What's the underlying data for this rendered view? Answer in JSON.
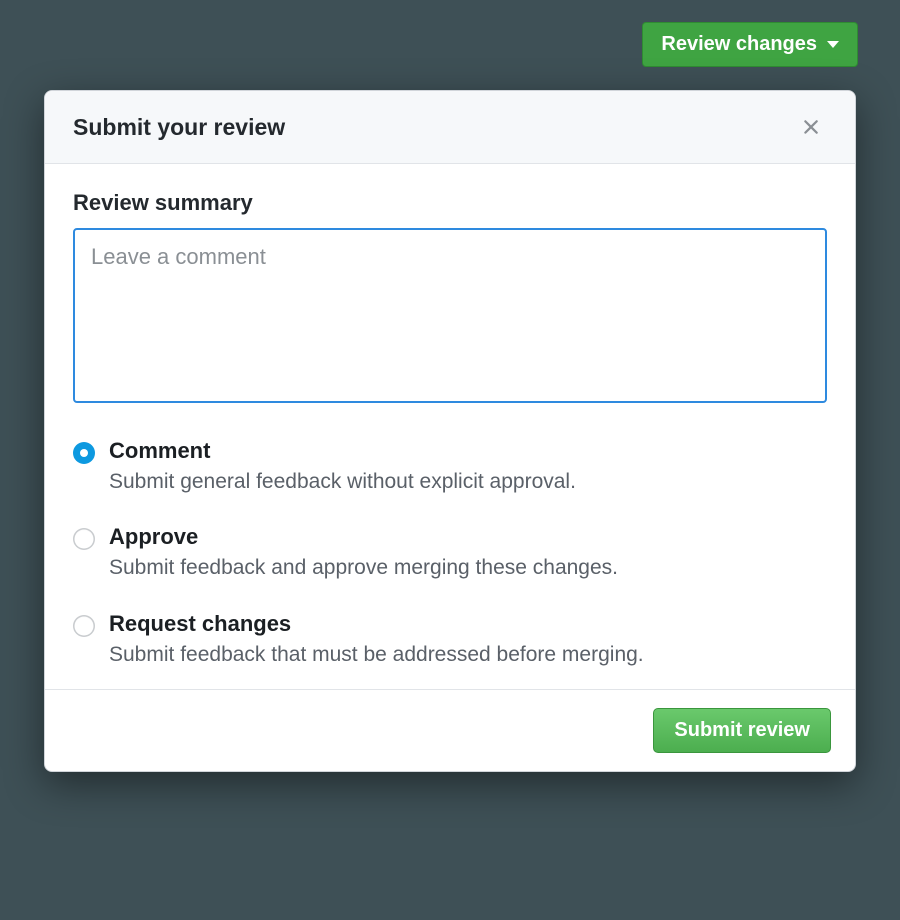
{
  "dropdown_button": {
    "label": "Review changes"
  },
  "popover": {
    "title": "Submit your review",
    "summary_label": "Review summary",
    "comment_placeholder": "Leave a comment",
    "comment_value": "",
    "options": [
      {
        "id": "comment",
        "title": "Comment",
        "description": "Submit general feedback without explicit approval.",
        "selected": true
      },
      {
        "id": "approve",
        "title": "Approve",
        "description": "Submit feedback and approve merging these changes.",
        "selected": false
      },
      {
        "id": "request_changes",
        "title": "Request changes",
        "description": "Submit feedback that must be addressed before merging.",
        "selected": false
      }
    ],
    "submit_label": "Submit review"
  }
}
